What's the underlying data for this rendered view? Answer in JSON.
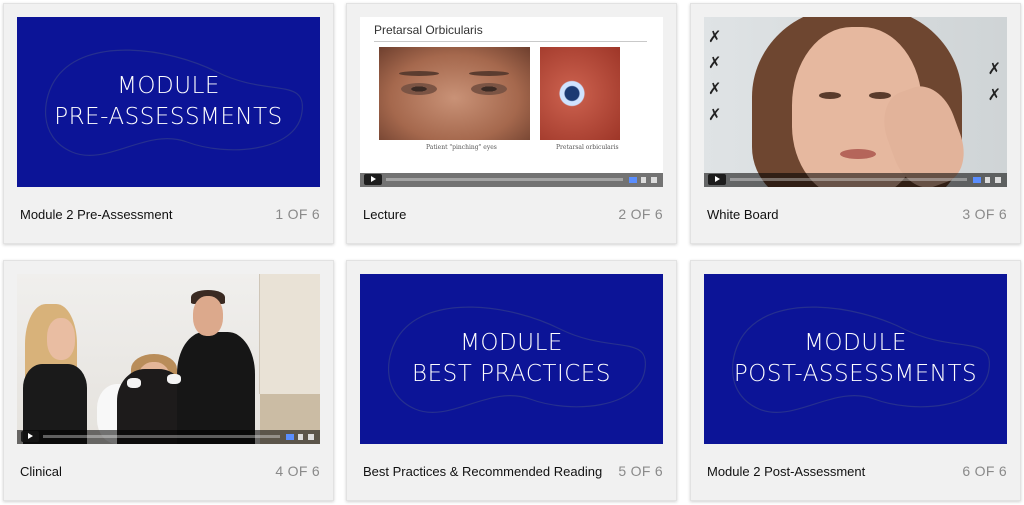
{
  "cards": [
    {
      "thumb_type": "title",
      "thumb_lines": [
        "MODULE",
        "PRE-ASSESSMENTS"
      ],
      "caption": "Module 2 Pre-Assessment",
      "counter": "1 OF 6"
    },
    {
      "thumb_type": "video",
      "slide_title": "Pretarsal Orbicularis",
      "slide_caption_left": "Patient \"pinching\" eyes",
      "slide_caption_right": "Pretarsal orbicularis",
      "caption": "Lecture",
      "counter": "2 OF 6"
    },
    {
      "thumb_type": "video",
      "caption": "White Board",
      "counter": "3 OF 6"
    },
    {
      "thumb_type": "video",
      "caption": "Clinical",
      "counter": "4 OF 6"
    },
    {
      "thumb_type": "title",
      "thumb_lines": [
        "MODULE",
        "BEST PRACTICES"
      ],
      "caption": "Best Practices & Recommended Reading",
      "counter": "5 OF 6"
    },
    {
      "thumb_type": "title",
      "thumb_lines": [
        "MODULE",
        "POST-ASSESSMENTS"
      ],
      "caption": "Module 2 Post-Assessment",
      "counter": "6 OF 6"
    }
  ],
  "colors": {
    "title_thumb_bg": "#0c1497",
    "card_bg": "#f1f1f1",
    "counter_text": "#8a8a8a"
  }
}
